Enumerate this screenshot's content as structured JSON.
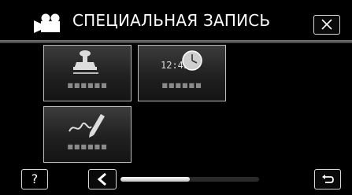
{
  "header": {
    "title": "СПЕЦИАЛЬНАЯ ЗАПИСЬ",
    "mode_icon": "video-camera-icon",
    "close_icon": "close-icon"
  },
  "tiles": [
    {
      "icon": "stamp-icon",
      "label": "■■■■■■"
    },
    {
      "icon": "clock-icon",
      "icon_text": "12:45",
      "label": "■■■■■■"
    },
    {
      "icon": "handwriting-icon",
      "label": "■■■■■■"
    }
  ],
  "footer": {
    "help_label": "?",
    "prev_icon": "chevron-left-icon",
    "back_icon": "return-icon",
    "scroll_position": 0.5
  },
  "colors": {
    "background": "#000000",
    "tile_border": "#bdbdbd",
    "text": "#ffffff"
  }
}
